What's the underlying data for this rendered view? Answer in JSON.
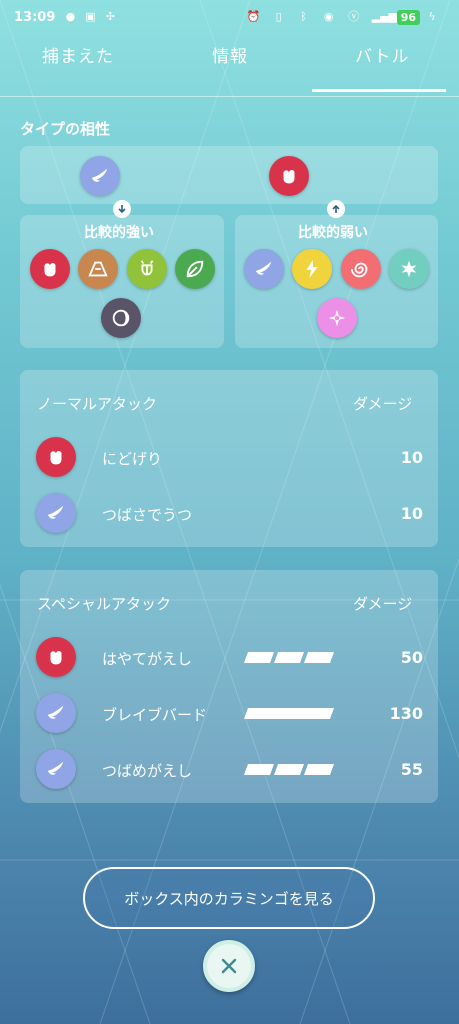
{
  "status_bar": {
    "time": "13:09",
    "battery": "96"
  },
  "tabs": [
    {
      "label": "捕まえた"
    },
    {
      "label": "情報"
    },
    {
      "label": "バトル"
    }
  ],
  "type_section": {
    "title": "タイプの相性",
    "pokemon_types": [
      "flying",
      "fighting"
    ],
    "strong": {
      "label": "比較的強い",
      "types": [
        "fighting",
        "rock",
        "bug",
        "grass",
        "dark"
      ]
    },
    "weak": {
      "label": "比較的弱い",
      "types": [
        "flying",
        "electric",
        "psychic",
        "ice",
        "fairy"
      ]
    }
  },
  "normal_attack": {
    "header": "ノーマルアタック",
    "damage_header": "ダメージ",
    "moves": [
      {
        "type": "fighting",
        "name": "にどげり",
        "damage": "10"
      },
      {
        "type": "flying",
        "name": "つばさでうつ",
        "damage": "10"
      }
    ]
  },
  "special_attack": {
    "header": "スペシャルアタック",
    "damage_header": "ダメージ",
    "moves": [
      {
        "type": "fighting",
        "name": "はやてがえし",
        "energy_bars": 3,
        "damage": "50"
      },
      {
        "type": "flying",
        "name": "ブレイブバード",
        "energy_bars": 1,
        "damage": "130"
      },
      {
        "type": "flying",
        "name": "つばめがえし",
        "energy_bars": 3,
        "damage": "55"
      }
    ]
  },
  "box_button": {
    "label": "ボックス内のカラミンゴを見る"
  },
  "colors": {
    "accent": "#ffffff",
    "battery": "#3fcf5a"
  }
}
